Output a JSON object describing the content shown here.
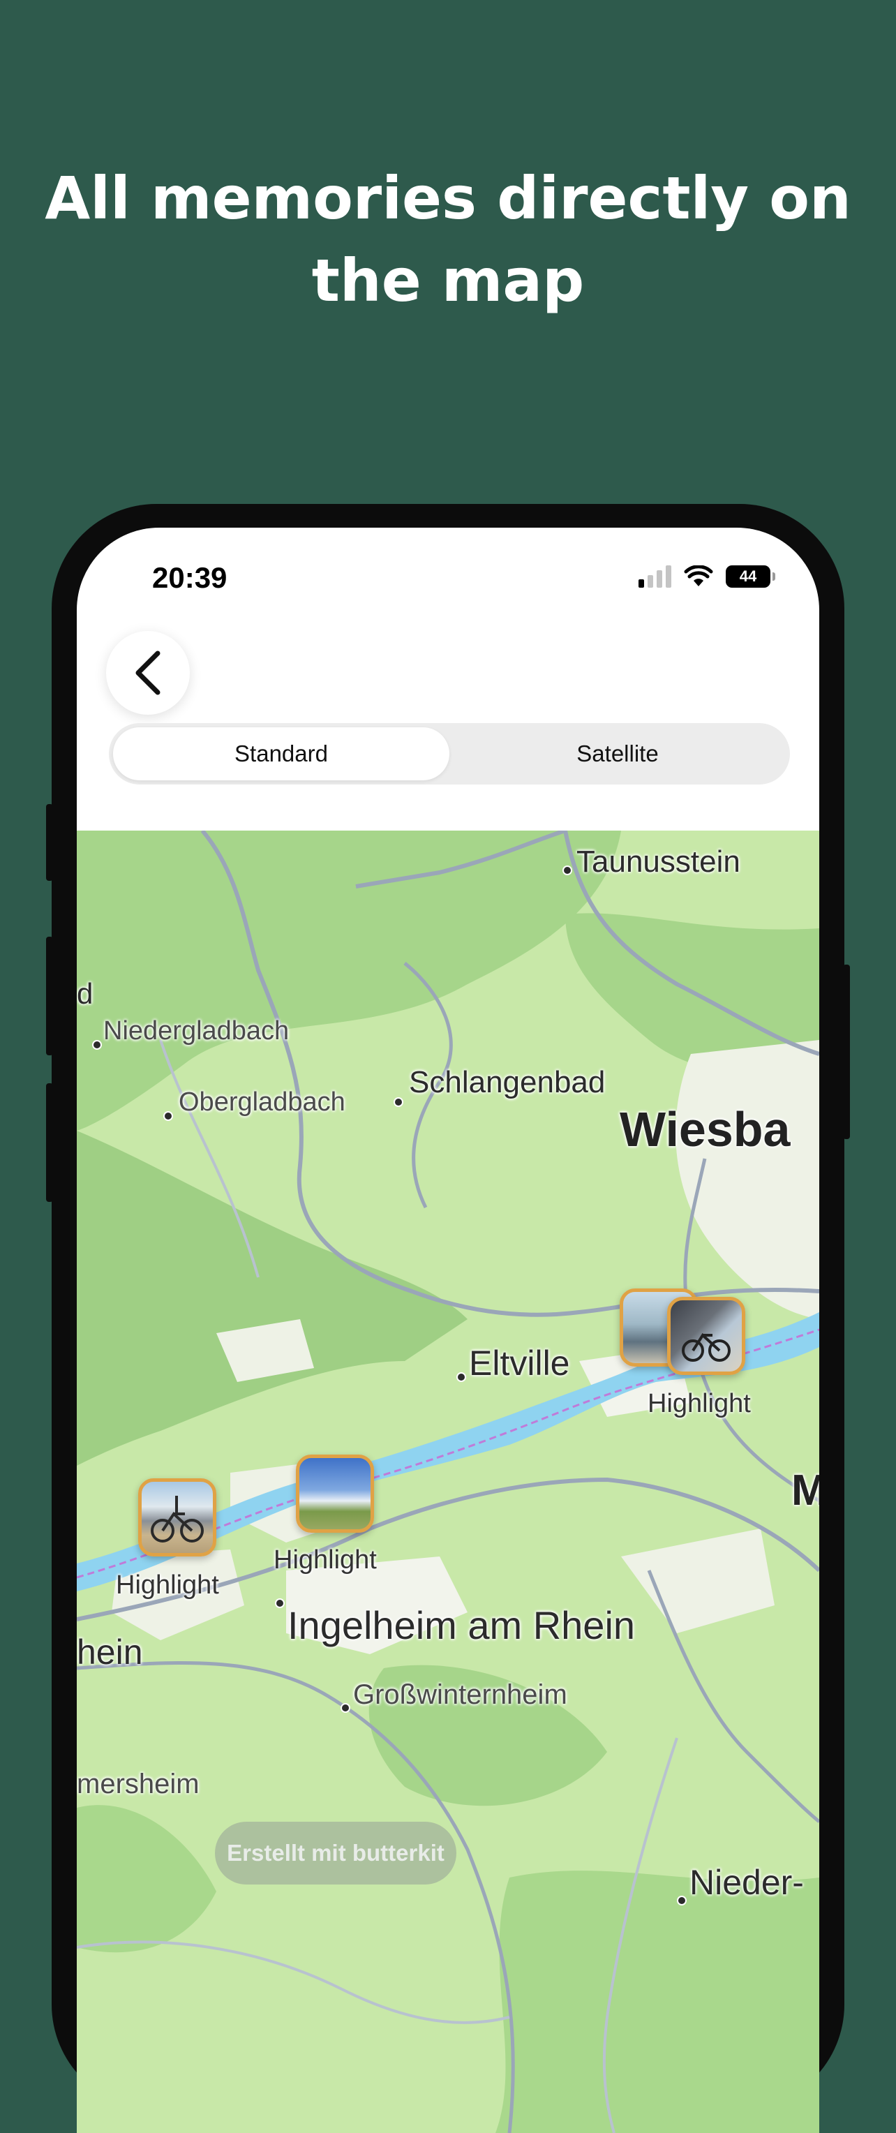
{
  "headline": {
    "line1": "All memories directly on",
    "line2": "the map"
  },
  "status_bar": {
    "time": "20:39",
    "battery": "44",
    "icons": [
      "signal-icon",
      "wifi-icon",
      "battery-icon"
    ]
  },
  "nav": {
    "back_icon": "chevron-left-icon"
  },
  "map_type": {
    "options": [
      "Standard",
      "Satellite"
    ],
    "selected": "Standard"
  },
  "map": {
    "places": {
      "taunusstein": "Taunusstein",
      "niedergladbach": "Niedergladbach",
      "obergladbach": "Obergladbach",
      "schlangenbad": "Schlangenbad",
      "wiesbaden": "Wiesba",
      "eltville": "Eltville",
      "ingelheim": "Ingelheim am Rhein",
      "grosswinternheim": "Großwinternheim",
      "nieder": "Nieder-",
      "hein": "hein",
      "mersheim": "mersheim",
      "edge_d": "d",
      "edge_m": "M"
    },
    "highlights": [
      {
        "label": "Highlight"
      },
      {
        "label": "Highlight"
      },
      {
        "label": "Highlight"
      }
    ],
    "colors": {
      "river": "#8fd3f0",
      "forest": "#a9d88c",
      "pin_border": "#e0a245"
    }
  },
  "footer": {
    "credit": "Erstellt mit butterkit"
  }
}
